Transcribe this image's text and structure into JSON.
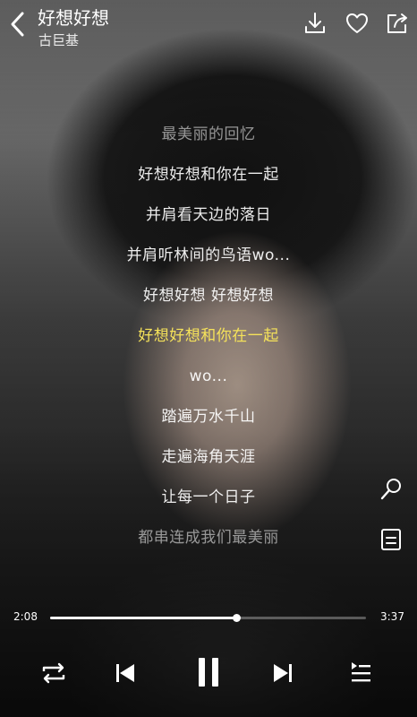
{
  "header": {
    "title": "好想好想",
    "artist": "古巨基"
  },
  "icons": {
    "back": "chevron-left-icon",
    "download": "download-icon",
    "favorite": "heart-icon",
    "share": "share-icon",
    "lyrics_search": "search-icon",
    "lyrics_panel": "document-icon",
    "play_mode": "repeat-icon",
    "previous": "skip-previous-icon",
    "pause": "pause-icon",
    "next": "skip-next-icon",
    "playlist": "playlist-icon"
  },
  "lyrics": [
    {
      "text": "最美丽的回忆",
      "state": "faded"
    },
    {
      "text": "好想好想和你在一起",
      "state": "normal"
    },
    {
      "text": "并肩看天边的落日",
      "state": "normal"
    },
    {
      "text": "并肩听林间的鸟语wo...",
      "state": "normal"
    },
    {
      "text": "好想好想 好想好想",
      "state": "normal"
    },
    {
      "text": "好想好想和你在一起",
      "state": "active"
    },
    {
      "text": "wo...",
      "state": "normal"
    },
    {
      "text": "踏遍万水千山",
      "state": "normal"
    },
    {
      "text": "走遍海角天涯",
      "state": "normal"
    },
    {
      "text": "让每一个日子",
      "state": "normal"
    },
    {
      "text": "都串连成我们最美丽",
      "state": "faded"
    }
  ],
  "progress": {
    "elapsed": "2:08",
    "duration": "3:37",
    "fraction": 0.59
  },
  "colors": {
    "active_lyric": "#f5e25a",
    "text": "#ffffff"
  }
}
